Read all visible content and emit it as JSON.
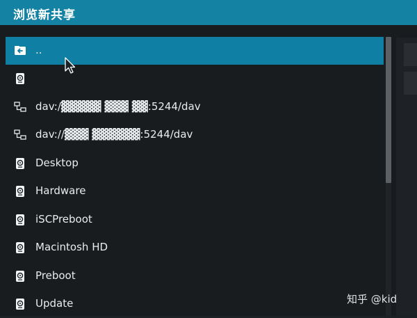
{
  "dialog": {
    "title": "浏览新共享"
  },
  "list": {
    "items": [
      {
        "label": "..",
        "icon": "folder-back-icon",
        "selected": true
      },
      {
        "label": "",
        "icon": "drive-icon"
      },
      {
        "label": "dav:/▓▓▓▓▓ ▓▓▓ ▓▓:5244/dav",
        "icon": "network-share-icon"
      },
      {
        "label": "dav://▓▓▓ ▓▓▓▓▓▓:5244/dav",
        "icon": "network-share-icon"
      },
      {
        "label": "Desktop",
        "icon": "drive-icon"
      },
      {
        "label": "Hardware",
        "icon": "drive-icon"
      },
      {
        "label": "iSCPreboot",
        "icon": "drive-icon"
      },
      {
        "label": "Macintosh HD",
        "icon": "drive-icon"
      },
      {
        "label": "Preboot",
        "icon": "drive-icon"
      },
      {
        "label": "Update",
        "icon": "drive-icon"
      }
    ]
  },
  "watermark": {
    "text": "知乎 @kid"
  },
  "colors": {
    "accent": "#1382a3",
    "selected": "#0f7fa3",
    "background": "#191c1f"
  }
}
